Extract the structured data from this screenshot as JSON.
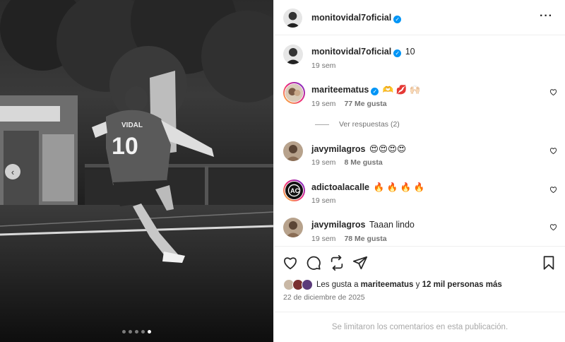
{
  "post": {
    "author": "monitovidal7oficial",
    "more_icon": "more-horizontal-icon",
    "media": {
      "jersey_name": "VIDAL",
      "jersey_number": "10",
      "carousel_prev_icon": "chevron-left-icon",
      "page_count": 5,
      "active_page": 5
    }
  },
  "caption": {
    "user": "monitovidal7oficial",
    "text": "10",
    "time": "19 sem"
  },
  "comments": [
    {
      "user": "mariteematus",
      "text": "🫶 💋 🙌🏻",
      "time": "19 sem",
      "likes": "77 Me gusta",
      "verified": true
    },
    {
      "user": "javymilagros",
      "text": "😍😍😍😍",
      "time": "19 sem",
      "likes": "8 Me gusta"
    },
    {
      "user": "adictoalacalle",
      "text": "🔥 🔥 🔥 🔥",
      "time": "19 sem",
      "likes": ""
    },
    {
      "user": "javymilagros",
      "text": "Taaan lindo",
      "time": "19 sem",
      "likes": "78 Me gusta"
    }
  ],
  "replies_toggle": "Ver respuestas (2)",
  "actions": {
    "like_icon": "heart-icon",
    "comment_icon": "comment-icon",
    "share_icon": "repost-icon",
    "send_icon": "send-icon",
    "save_icon": "bookmark-icon"
  },
  "likes_summary": {
    "prefix": "Les gusta a",
    "user": "mariteematus",
    "joiner": "y",
    "others": "12 mil personas más"
  },
  "date": "22 de diciembre de 2025",
  "footer_note": "Se limitaron los comentarios en esta publicación.",
  "colors": {
    "verified": "#0095f6",
    "text": "#262626",
    "muted": "#737373",
    "divider": "#efefef"
  }
}
